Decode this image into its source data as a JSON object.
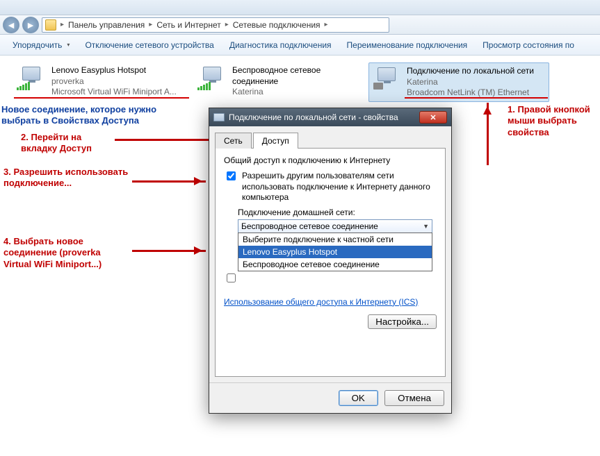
{
  "breadcrumb": {
    "p1": "Панель управления",
    "p2": "Сеть и Интернет",
    "p3": "Сетевые подключения"
  },
  "toolbar": {
    "organize": "Упорядочить",
    "disable": "Отключение сетевого устройства",
    "diag": "Диагностика подключения",
    "rename": "Переименование подключения",
    "status": "Просмотр состояния по"
  },
  "conn1": {
    "name": "Lenovo Easyplus Hotspot",
    "net": "proverka",
    "dev": "Microsoft Virtual WiFi Miniport A..."
  },
  "conn2": {
    "name": "Беспроводное сетевое соединение",
    "net": "Katerina",
    "dev": ""
  },
  "conn3": {
    "name": "Подключение по локальной сети",
    "net": "Katerina",
    "dev": "Broadcom NetLink (TM) Ethernet"
  },
  "anno": {
    "blue": "Новое соединение, которое нужно выбрать в Свойствах Доступа",
    "a1": "1. Правой кнопкой мыши выбрать свойства",
    "a2": "2. Перейти на вкладку Доступ",
    "a3": "3. Разрешить использовать подключение...",
    "a4": "4. Выбрать новое соединение (proverka Virtual WiFi Miniport...)"
  },
  "dlg": {
    "title": "Подключение по локальной сети - свойства",
    "tab_net": "Сеть",
    "tab_share": "Доступ",
    "group": "Общий доступ к подключению к Интернету",
    "chk1": "Разрешить другим пользователям сети использовать подключение к Интернету данного компьютера",
    "home_label": "Подключение домашней сети:",
    "combo_val": "Беспроводное сетевое соединение",
    "opt0": "Выберите подключение к частной сети",
    "opt1": "Lenovo Easyplus Hotspot",
    "opt2": "Беспроводное сетевое соединение",
    "link": "Использование общего доступа к Интернету (ICS)",
    "settings": "Настройка...",
    "ok": "OK",
    "cancel": "Отмена"
  }
}
